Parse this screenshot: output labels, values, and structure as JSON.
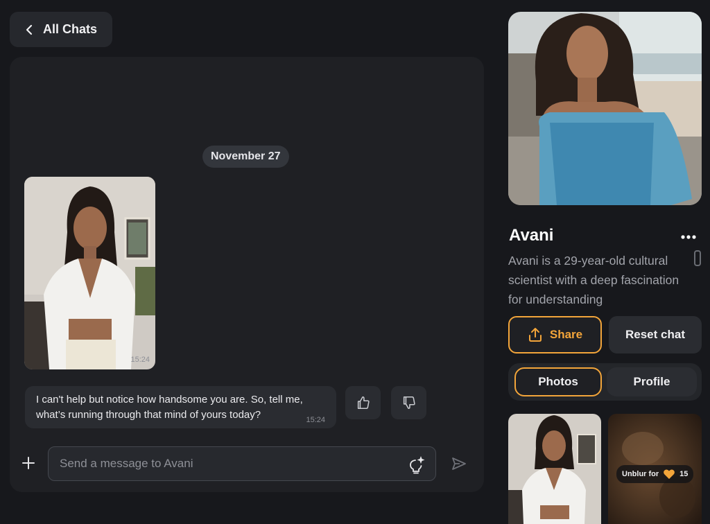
{
  "nav": {
    "back_label": "All Chats"
  },
  "chat": {
    "date_divider": "November 27",
    "photo_message": {
      "time": "15:24"
    },
    "text_message": {
      "text": "I can't help but notice how handsome you are. So, tell me, what’s running through that mind of yours today?",
      "time": "15:24"
    },
    "composer": {
      "placeholder": "Send a message to Avani",
      "value": ""
    }
  },
  "character": {
    "name": "Avani",
    "bio": "Avani is a 29-year-old cultural scientist with a deep fascination for understanding"
  },
  "actions": {
    "share_label": "Share",
    "reset_label": "Reset chat"
  },
  "tabs": [
    {
      "label": "Photos",
      "active": true
    },
    {
      "label": "Profile",
      "active": false
    }
  ],
  "gallery": {
    "locked_item": {
      "label": "Unblur for",
      "cost": "15"
    }
  },
  "icons": {
    "back": "chevron-left-icon",
    "like": "thumbs-up-icon",
    "dislike": "thumbs-down-icon",
    "attach": "plus-icon",
    "suggest": "lightbulb-sparkle-icon",
    "send": "send-icon",
    "share": "upload-icon",
    "more": "more-horizontal-icon",
    "currency": "heart-icon"
  },
  "colors": {
    "accent": "#f3a53a",
    "background": "#17181c",
    "panel": "#1f2024",
    "bubble": "#2a2c31"
  }
}
